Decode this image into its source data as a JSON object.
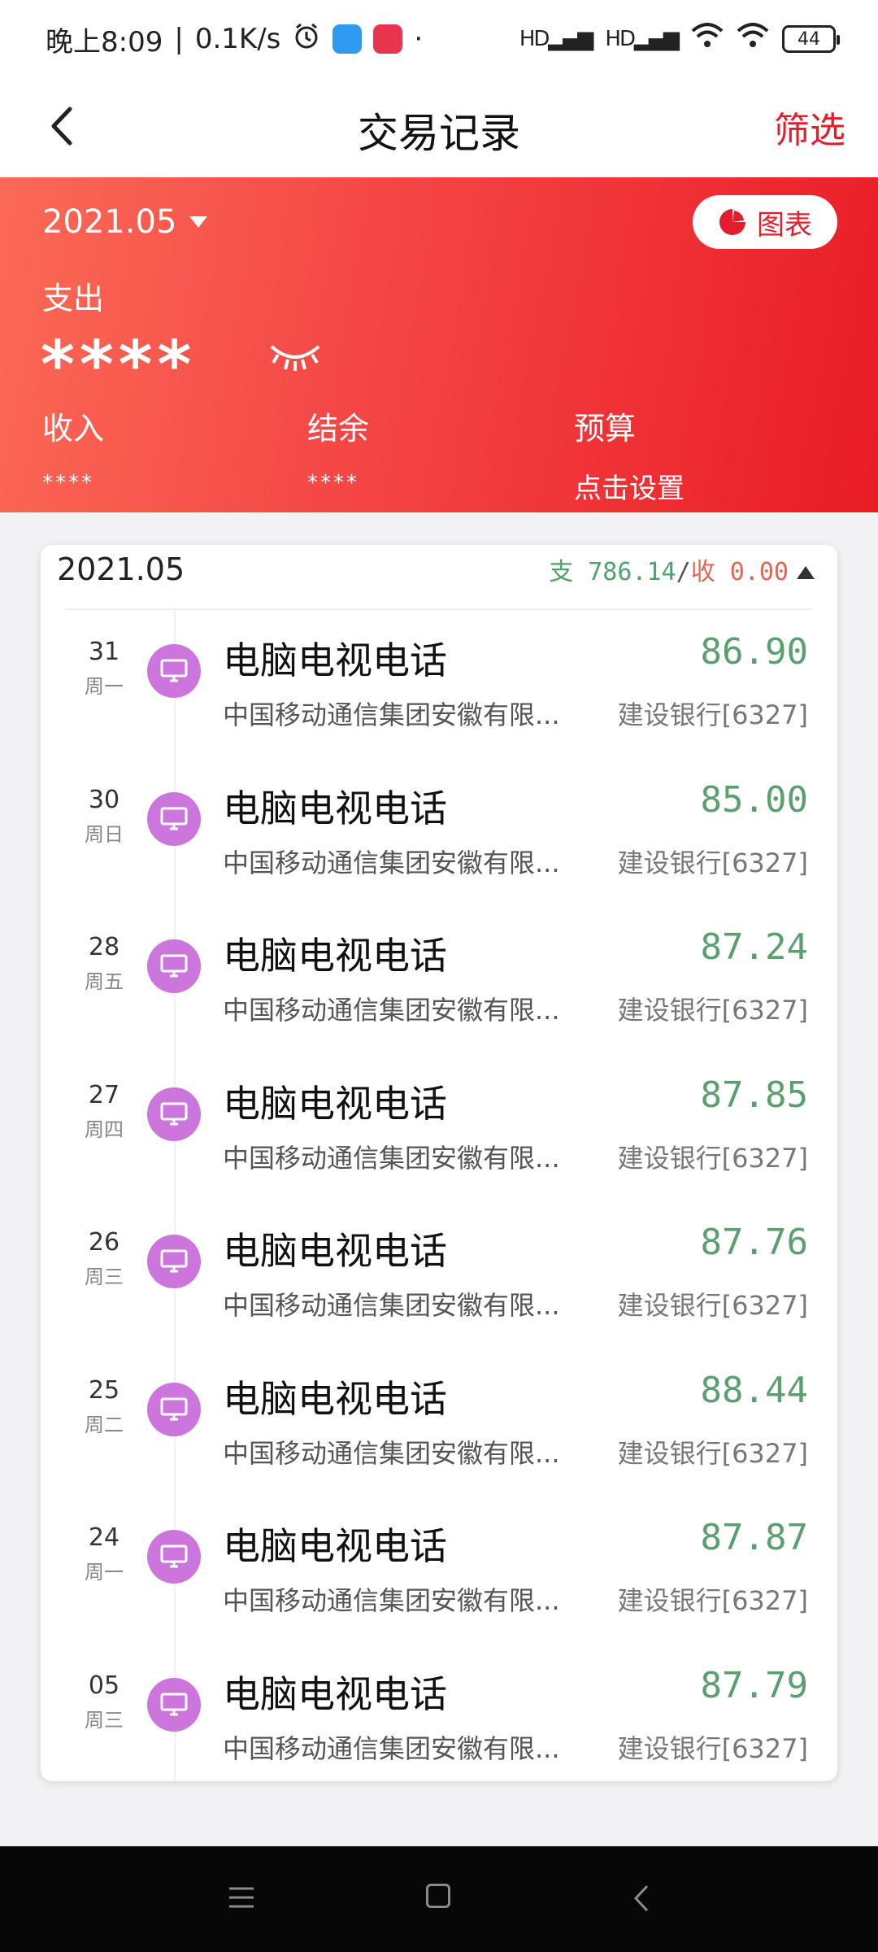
{
  "status_bar": {
    "time": "晚上8:09",
    "net_speed": "0.1K/s",
    "dot": "·",
    "signal1": "HD",
    "signal2": "HD",
    "battery": "44"
  },
  "nav": {
    "title": "交易记录",
    "filter_label": "筛选"
  },
  "header": {
    "month": "2021.05",
    "chart_button": "图表",
    "expense_label": "支出",
    "expense_value": "****",
    "income_label": "收入",
    "income_value": "****",
    "balance_label": "结余",
    "balance_value": "****",
    "budget_label": "预算",
    "budget_value": "点击设置"
  },
  "list": {
    "month": "2021.05",
    "expense_label": "支",
    "expense_total": "786.14",
    "separator": "/",
    "income_label": "收",
    "income_total": "0.00",
    "rows": [
      {
        "day": "31",
        "weekday": "周一",
        "category": "电脑电视电话",
        "merchant": "中国移动通信集团安徽有限...",
        "amount": "86.90",
        "bank": "建设银行[6327]"
      },
      {
        "day": "30",
        "weekday": "周日",
        "category": "电脑电视电话",
        "merchant": "中国移动通信集团安徽有限...",
        "amount": "85.00",
        "bank": "建设银行[6327]"
      },
      {
        "day": "28",
        "weekday": "周五",
        "category": "电脑电视电话",
        "merchant": "中国移动通信集团安徽有限...",
        "amount": "87.24",
        "bank": "建设银行[6327]"
      },
      {
        "day": "27",
        "weekday": "周四",
        "category": "电脑电视电话",
        "merchant": "中国移动通信集团安徽有限...",
        "amount": "87.85",
        "bank": "建设银行[6327]"
      },
      {
        "day": "26",
        "weekday": "周三",
        "category": "电脑电视电话",
        "merchant": "中国移动通信集团安徽有限...",
        "amount": "87.76",
        "bank": "建设银行[6327]"
      },
      {
        "day": "25",
        "weekday": "周二",
        "category": "电脑电视电话",
        "merchant": "中国移动通信集团安徽有限...",
        "amount": "88.44",
        "bank": "建设银行[6327]"
      },
      {
        "day": "24",
        "weekday": "周一",
        "category": "电脑电视电话",
        "merchant": "中国移动通信集团安徽有限...",
        "amount": "87.87",
        "bank": "建设银行[6327]"
      },
      {
        "day": "05",
        "weekday": "周三",
        "category": "电脑电视电话",
        "merchant": "中国移动通信集团安徽有限...",
        "amount": "87.79",
        "bank": "建设银行[6327]"
      }
    ]
  },
  "colors": {
    "accent_red": "#e21e2d",
    "expense_green": "#5a9f6e",
    "income_orange": "#e4664f",
    "category_purple": "#cc75dc"
  }
}
